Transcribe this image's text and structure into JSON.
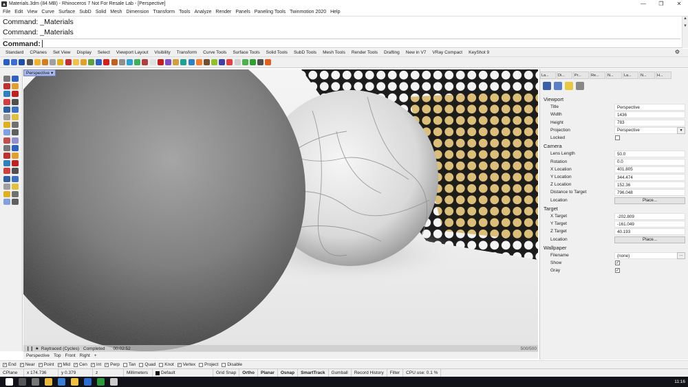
{
  "window": {
    "title": "Materials.3dm (84 MB) - Rhinoceros 7 Not For Resale Lab - [Perspective]"
  },
  "menu": [
    "File",
    "Edit",
    "View",
    "Curve",
    "Surface",
    "SubD",
    "Solid",
    "Mesh",
    "Dimension",
    "Transform",
    "Tools",
    "Analyze",
    "Render",
    "Panels",
    "Paneling Tools",
    "Twinmotion 2020",
    "Help"
  ],
  "command": {
    "history": [
      "Command: _Materials",
      "Command: _Materials"
    ],
    "prompt": "Command:"
  },
  "tabs": [
    "Standard",
    "CPlanes",
    "Set View",
    "Display",
    "Select",
    "Viewport Layout",
    "Visibility",
    "Transform",
    "Curve Tools",
    "Surface Tools",
    "Solid Tools",
    "SubD Tools",
    "Mesh Tools",
    "Render Tools",
    "Drafting",
    "New in V7",
    "VRay Compact",
    "KeyShot 9"
  ],
  "viewport": {
    "name": "Perspective",
    "status": "Raytraced (Cycles)",
    "state": "Completed",
    "time": "00:02:52",
    "samples": "500/500"
  },
  "viewport_tabs": [
    "Perspective",
    "Top",
    "Front",
    "Right"
  ],
  "panel": {
    "tabs": [
      "La...",
      "Di...",
      "Pr...",
      "Re...",
      "N...",
      "La...",
      "N...",
      "H..."
    ],
    "viewport_title": "Viewport",
    "viewport_rows": [
      {
        "label": "Title",
        "value": "Perspective"
      },
      {
        "label": "Width",
        "value": "1436"
      },
      {
        "label": "Height",
        "value": "783"
      },
      {
        "label": "Projection",
        "value": "Perspective"
      },
      {
        "label": "Locked",
        "value": ""
      }
    ],
    "camera_title": "Camera",
    "camera_rows": [
      {
        "label": "Lens Length",
        "value": "50.0"
      },
      {
        "label": "Rotation",
        "value": "0.0"
      },
      {
        "label": "X Location",
        "value": "401.805"
      },
      {
        "label": "Y Location",
        "value": "344.474"
      },
      {
        "label": "Z Location",
        "value": "152.36"
      },
      {
        "label": "Distance to Target",
        "value": "796.048"
      },
      {
        "label": "Location",
        "value": "Place..."
      }
    ],
    "target_title": "Target",
    "target_rows": [
      {
        "label": "X Target",
        "value": "-202.809"
      },
      {
        "label": "Y Target",
        "value": "-161.049"
      },
      {
        "label": "Z Target",
        "value": "40.193"
      },
      {
        "label": "Location",
        "value": "Place..."
      }
    ],
    "wallpaper_title": "Wallpaper",
    "wallpaper_rows": [
      {
        "label": "Filename",
        "value": "(none)"
      },
      {
        "label": "Show",
        "value": "✓"
      },
      {
        "label": "Gray",
        "value": "✓"
      }
    ]
  },
  "osnap": [
    {
      "label": "End",
      "checked": true
    },
    {
      "label": "Near",
      "checked": true
    },
    {
      "label": "Point",
      "checked": true
    },
    {
      "label": "Mid",
      "checked": true
    },
    {
      "label": "Cen",
      "checked": true
    },
    {
      "label": "Int",
      "checked": true
    },
    {
      "label": "Perp",
      "checked": true
    },
    {
      "label": "Tan",
      "checked": false
    },
    {
      "label": "Quad",
      "checked": false
    },
    {
      "label": "Knot",
      "checked": false
    },
    {
      "label": "Vertex",
      "checked": true
    },
    {
      "label": "Project",
      "checked": false
    },
    {
      "label": "Disable",
      "checked": false
    }
  ],
  "status": {
    "cplane": "CPlane",
    "x": "x 174.736",
    "y": "y 0.379",
    "z": "z",
    "units": "Millimeters",
    "layer": "Default",
    "buttons": [
      "Grid Snap",
      "Ortho",
      "Planar",
      "Osnap",
      "SmartTrack",
      "Gumball",
      "Record History",
      "Filter"
    ],
    "cpu": "CPU use: 0.1 %"
  },
  "clock": "11:16"
}
